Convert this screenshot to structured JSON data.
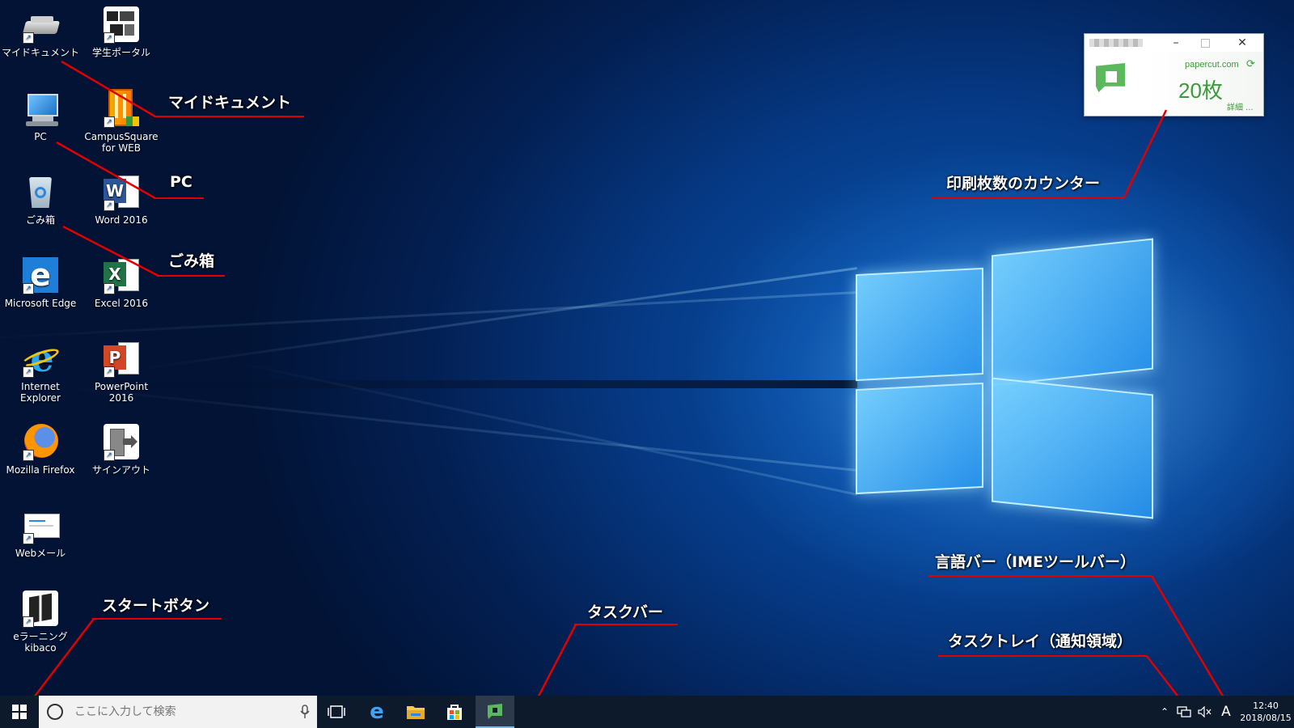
{
  "desktop_icons": [
    {
      "id": "my-documents",
      "label": "マイドキュメント"
    },
    {
      "id": "student-portal",
      "label": "学生ポータル"
    },
    {
      "id": "pc",
      "label": "PC"
    },
    {
      "id": "campussquare",
      "label": "CampusSquare for WEB"
    },
    {
      "id": "recycle-bin",
      "label": "ごみ箱"
    },
    {
      "id": "word",
      "label": "Word 2016"
    },
    {
      "id": "edge",
      "label": "Microsoft Edge"
    },
    {
      "id": "excel",
      "label": "Excel 2016"
    },
    {
      "id": "ie",
      "label": "Internet Explorer"
    },
    {
      "id": "powerpoint",
      "label": "PowerPoint 2016"
    },
    {
      "id": "firefox",
      "label": "Mozilla Firefox"
    },
    {
      "id": "signout",
      "label": "サインアウト"
    },
    {
      "id": "webmail",
      "label": "Webメール"
    },
    {
      "id": "kibaco",
      "label": "eラーニングkibaco"
    }
  ],
  "annotations": {
    "my_documents": "マイドキュメント",
    "pc": "PC",
    "recycle_bin": "ごみ箱",
    "print_counter": "印刷枚数のカウンター",
    "language_bar": "言語バー（IMEツールバー）",
    "task_tray": "タスクトレイ（通知領域）",
    "taskbar": "タスクバー",
    "start_button": "スタートボタン"
  },
  "papercut": {
    "domain": "papercut.com",
    "count": "20枚",
    "details_link": "詳細 ..."
  },
  "taskbar": {
    "search_placeholder": "ここに入力して検索",
    "ime_indicator": "A",
    "time": "12:40",
    "date": "2018/08/15"
  },
  "colors": {
    "annotation_line": "#e00000",
    "papercut_green": "#5cb85c",
    "taskbar_bg": "#0d1a2b",
    "active_app_underline": "#76b9ed"
  }
}
